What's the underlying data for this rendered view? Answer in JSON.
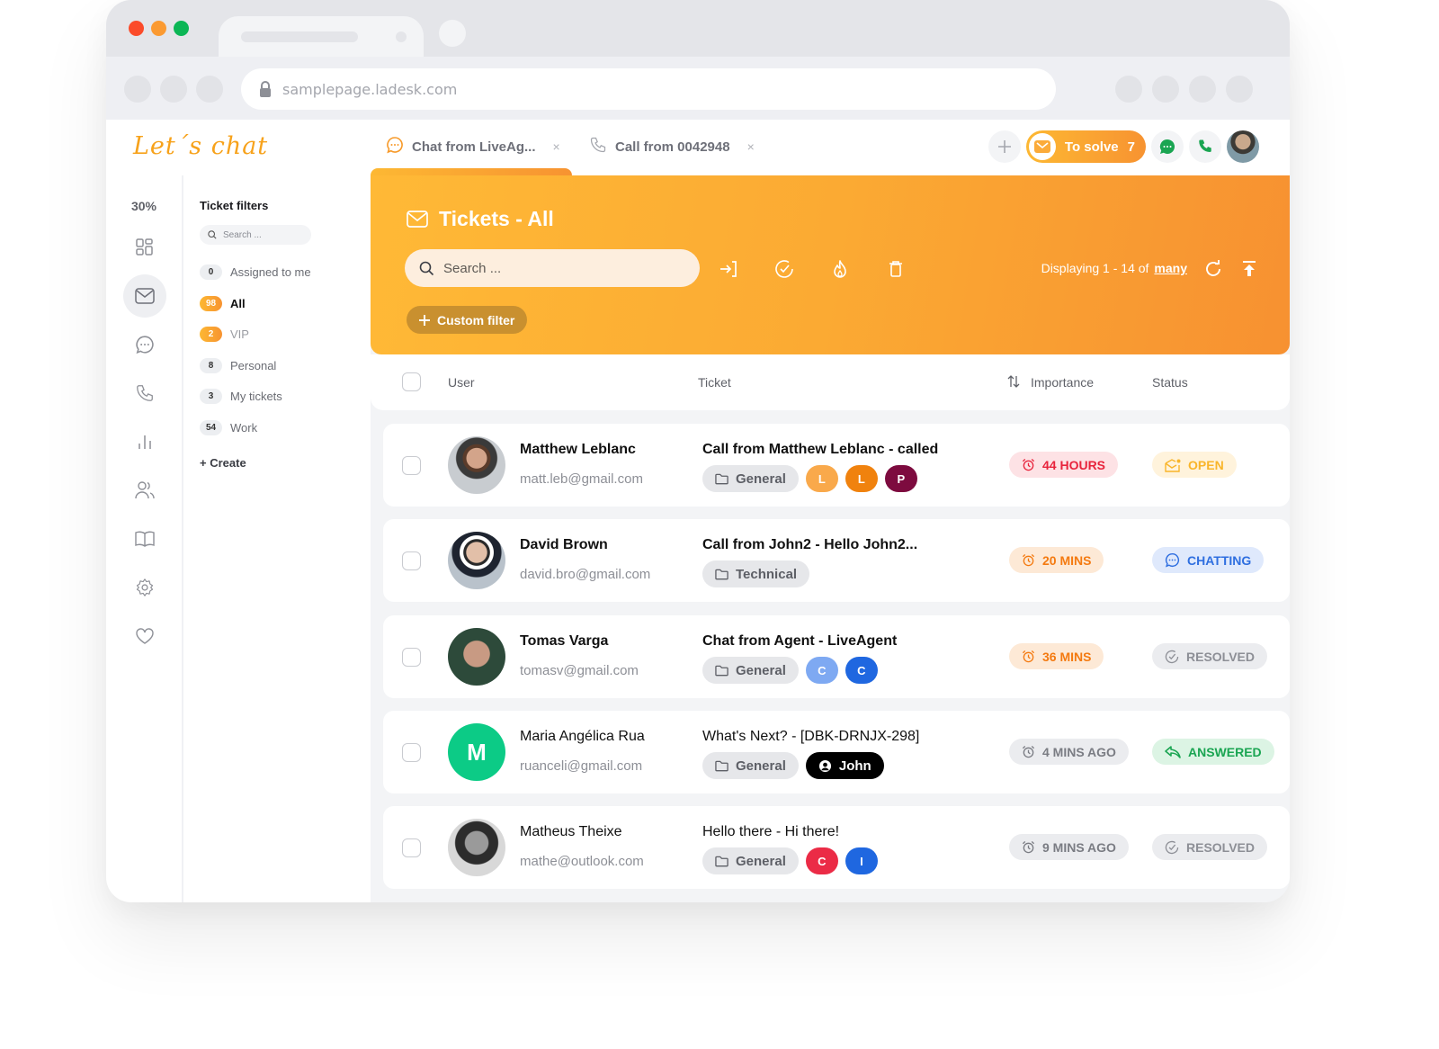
{
  "browser": {
    "url": "samplepage.ladesk.com"
  },
  "app": {
    "logo": "Let´s chat",
    "tabs": [
      {
        "label": "Chat from LiveAg...",
        "icon": "chat-bubble-icon",
        "close": "×"
      },
      {
        "label": "Call from 0042948",
        "icon": "phone-icon",
        "close": "×"
      }
    ],
    "to_solve": {
      "label": "To solve",
      "count": "7"
    }
  },
  "rail": {
    "percent": "30%",
    "items": [
      "dashboard",
      "tickets",
      "chats",
      "calls",
      "reports",
      "customers",
      "knowledgebase",
      "configuration",
      "favorites"
    ]
  },
  "filters": {
    "title": "Ticket filters",
    "search_placeholder": "Search ...",
    "items": [
      {
        "count": "0",
        "label": "Assigned to me",
        "highlight": false,
        "active": false
      },
      {
        "count": "98",
        "label": "All",
        "highlight": true,
        "active": true
      },
      {
        "count": "2",
        "label": "VIP",
        "highlight": true,
        "active": false
      },
      {
        "count": "8",
        "label": "Personal",
        "highlight": false,
        "active": false
      },
      {
        "count": "3",
        "label": "My tickets",
        "highlight": false,
        "active": false
      },
      {
        "count": "54",
        "label": "Work",
        "highlight": false,
        "active": false
      }
    ],
    "create_label": "+ Create"
  },
  "main": {
    "title": "Tickets - All",
    "search_placeholder": "Search ...",
    "display_prefix": "Displaying 1 - 14 of",
    "display_link": "many",
    "custom_filter_label": "Custom filter",
    "columns": {
      "user": "User",
      "ticket": "Ticket",
      "importance": "Importance",
      "status": "Status"
    }
  },
  "colors": {
    "brand_orange": "#f79331",
    "brand_yellow": "#fdb833",
    "open": "#f9b52a",
    "chatting": "#2f6fe0",
    "answered": "#1aa552",
    "resolved": "#8d8f96",
    "urgent": "#e8233c"
  },
  "tickets": [
    {
      "name": "Matthew Leblanc",
      "email": "matt.leb@gmail.com",
      "subject": "Call from Matthew Leblanc - called",
      "subject_bold": true,
      "department": "General",
      "agents": [
        {
          "initial": "L",
          "color": "#f9a94b"
        },
        {
          "initial": "L",
          "color": "#f0820e"
        },
        {
          "initial": "P",
          "color": "#7d0b3f"
        }
      ],
      "importance": "44 HOURS",
      "importance_kind": "urgent",
      "status": "OPEN",
      "status_kind": "open"
    },
    {
      "name": "David Brown",
      "email": "david.bro@gmail.com",
      "subject": "Call from John2 - Hello John2...",
      "subject_bold": true,
      "department": "Technical",
      "agents": [],
      "importance": "20 MINS",
      "importance_kind": "warn",
      "status": "CHATTING",
      "status_kind": "chatting"
    },
    {
      "name": "Tomas Varga",
      "email": "tomasv@gmail.com",
      "subject": "Chat from Agent - LiveAgent",
      "subject_bold": true,
      "department": "General",
      "agents": [
        {
          "initial": "C",
          "color": "#7ea9f2"
        },
        {
          "initial": "C",
          "color": "#1f67e0"
        }
      ],
      "importance": "36 MINS",
      "importance_kind": "warn",
      "status": "RESOLVED",
      "status_kind": "resolved"
    },
    {
      "name": "Maria Angélica Rua",
      "email": "ruanceli@gmail.com",
      "initial": "M",
      "subject": "What's Next? - [DBK-DRNJX-298]",
      "subject_bold": false,
      "department": "General",
      "assignee": "John",
      "agents": [],
      "importance": "4 MINS AGO",
      "importance_kind": "neutral",
      "status": "ANSWERED",
      "status_kind": "answered"
    },
    {
      "name": "Matheus Theixe",
      "email": "mathe@outlook.com",
      "subject": "Hello there - Hi there!",
      "subject_bold": false,
      "department": "General",
      "agents": [
        {
          "initial": "C",
          "color": "#eb2b46"
        },
        {
          "initial": "I",
          "color": "#1f67e0"
        }
      ],
      "importance": "9 MINS AGO",
      "importance_kind": "neutral",
      "status": "RESOLVED",
      "status_kind": "resolved"
    }
  ]
}
